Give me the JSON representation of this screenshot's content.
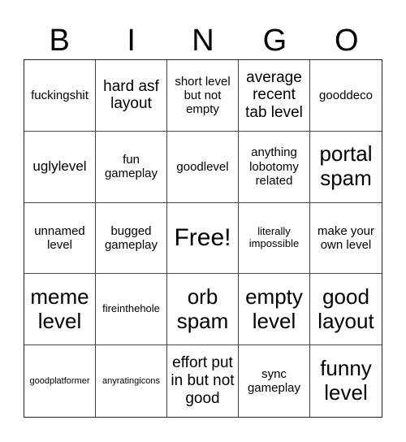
{
  "header": [
    "B",
    "I",
    "N",
    "G",
    "O"
  ],
  "cells": [
    {
      "text": "fuckingshit",
      "size": "s-m"
    },
    {
      "text": "hard asf layout",
      "size": "s-l"
    },
    {
      "text": "short level but not empty",
      "size": "s-m"
    },
    {
      "text": "average recent tab level",
      "size": "s-l"
    },
    {
      "text": "gooddeco",
      "size": "s-m"
    },
    {
      "text": "uglylevel",
      "size": "s-md"
    },
    {
      "text": "fun gameplay",
      "size": "s-m"
    },
    {
      "text": "goodlevel",
      "size": "s-m"
    },
    {
      "text": "anything lobotomy related",
      "size": "s-m"
    },
    {
      "text": "portal spam",
      "size": "s-xl"
    },
    {
      "text": "unnamed level",
      "size": "s-m"
    },
    {
      "text": "bugged gameplay",
      "size": "s-m"
    },
    {
      "text": "Free!",
      "size": "s-xxl"
    },
    {
      "text": "literally impossible",
      "size": "s-s"
    },
    {
      "text": "make your own level",
      "size": "s-m"
    },
    {
      "text": "meme level",
      "size": "s-xl"
    },
    {
      "text": "fireinthehole",
      "size": "s-s"
    },
    {
      "text": "orb spam",
      "size": "s-xl"
    },
    {
      "text": "empty level",
      "size": "s-xl"
    },
    {
      "text": "good layout",
      "size": "s-xl"
    },
    {
      "text": "goodplatformer",
      "size": "s-xs"
    },
    {
      "text": "anyratingicons",
      "size": "s-xs"
    },
    {
      "text": "effort put in but not good",
      "size": "s-l"
    },
    {
      "text": "sync gameplay",
      "size": "s-m"
    },
    {
      "text": "funny level",
      "size": "s-xl"
    }
  ]
}
